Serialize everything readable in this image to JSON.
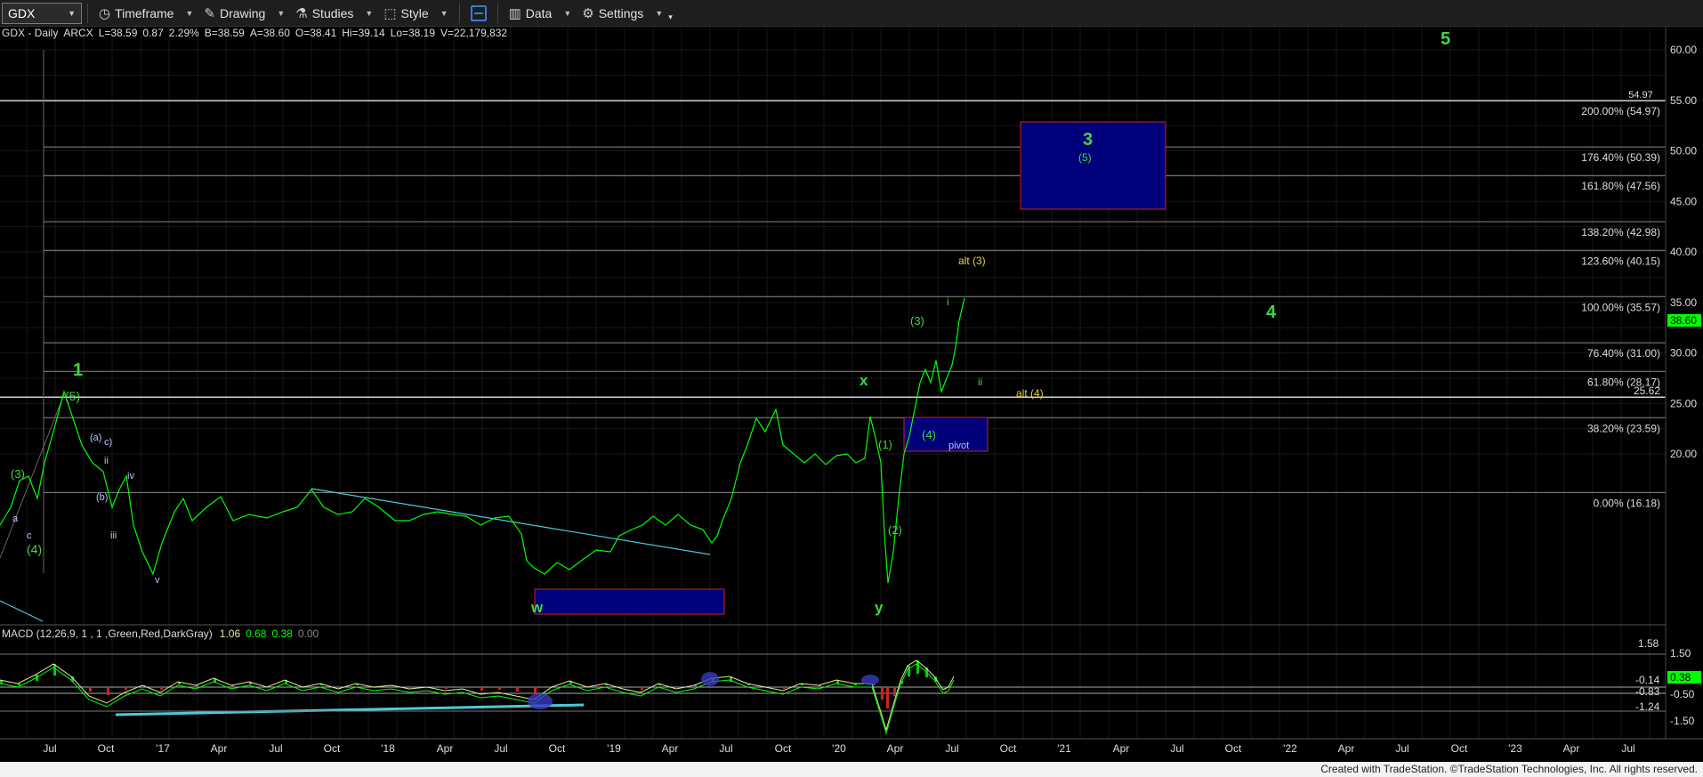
{
  "toolbar": {
    "symbol": "GDX",
    "timeframe": "Timeframe",
    "drawing": "Drawing",
    "studies": "Studies",
    "style": "Style",
    "data": "Data",
    "settings": "Settings"
  },
  "header": {
    "symbol": "GDX - Daily",
    "exchange": "ARCX",
    "last": "L=38.59",
    "change": "0.87",
    "change_pct": "2.29%",
    "bid": "B=38.59",
    "ask": "A=38.60",
    "open": "O=38.41",
    "high": "Hi=39.14",
    "low": "Lo=38.19",
    "volume": "V=22,179,832"
  },
  "price_axis": {
    "labels": [
      "60.00",
      "55.00",
      "50.00",
      "45.00",
      "40.00",
      "35.00",
      "30.00",
      "25.00",
      "20.00"
    ],
    "current_price": "38.60"
  },
  "time_axis": {
    "labels": [
      "Jul",
      "Oct",
      "'17",
      "Apr",
      "Jul",
      "Oct",
      "'18",
      "Apr",
      "Jul",
      "Oct",
      "'19",
      "Apr",
      "Jul",
      "Oct",
      "'20",
      "Apr",
      "Jul",
      "Oct",
      "'21",
      "Apr",
      "Jul",
      "Oct",
      "'22",
      "Apr",
      "Jul",
      "Oct",
      "'23",
      "Apr",
      "Jul"
    ]
  },
  "fib_levels": [
    {
      "label": "200.00% (54.97)",
      "price": 54.97
    },
    {
      "label": "176.40% (50.39)",
      "price": 50.39
    },
    {
      "label": "161.80% (47.56)",
      "price": 47.56
    },
    {
      "label": "138.20% (42.98)",
      "price": 42.98
    },
    {
      "label": "123.60% (40.15)",
      "price": 40.15
    },
    {
      "label": "100.00% (35.57)",
      "price": 35.57
    },
    {
      "label": "76.40% (31.00)",
      "price": 31.0
    },
    {
      "label": "61.80% (28.17)",
      "price": 28.17
    },
    {
      "label": "38.20% (23.59)",
      "price": 23.59
    },
    {
      "label": "0.00% (16.18)",
      "price": 16.18
    }
  ],
  "extra_level": {
    "label": "25.62",
    "price": 25.62
  },
  "top_line_label": "54.97",
  "wave_labels": {
    "w1": "1",
    "w1_5": "(5)",
    "w3_top": "3",
    "w3_5": "(5)",
    "w4": "4",
    "w5": "5",
    "alt3": "alt (3)",
    "alt4": "alt (4)",
    "p3": "(3)",
    "p4": "(4)",
    "p1": "(1)",
    "p2": "(2)",
    "pivot": "pivot",
    "x": "x",
    "y": "y",
    "w": "w",
    "i": "i",
    "ii": "ii",
    "a_paren": "(a)",
    "c_paren": "c)",
    "b_paren": "(b)",
    "left3": "(3)",
    "left4": "(4)",
    "ii_small": "ii",
    "iv": "iv",
    "iii": "iii",
    "v": "v",
    "a": "a",
    "c": "c"
  },
  "macd": {
    "label": "MACD (12,26,9, 1 , 1 ,Green,Red,DarkGray)",
    "v1": "1.06",
    "v2": "0.68",
    "v3": "0.38",
    "v4": "0.00",
    "axis_labels": [
      "1.58",
      "1.50",
      "0.38",
      "-0.14",
      "-0.50",
      "-0.83",
      "-1.24",
      "-1.50"
    ]
  },
  "footer": "Created with TradeStation. ©TradeStation Technologies, Inc. All rights reserved.",
  "colors": {
    "price": "#00ff00",
    "wave_green": "#3ed83e",
    "wave_yellow": "#e6d33c",
    "box_fill": "#00007a",
    "box_border": "#cc2222",
    "trendline": "#4fc9d9",
    "grid": "#1c1c1c"
  }
}
